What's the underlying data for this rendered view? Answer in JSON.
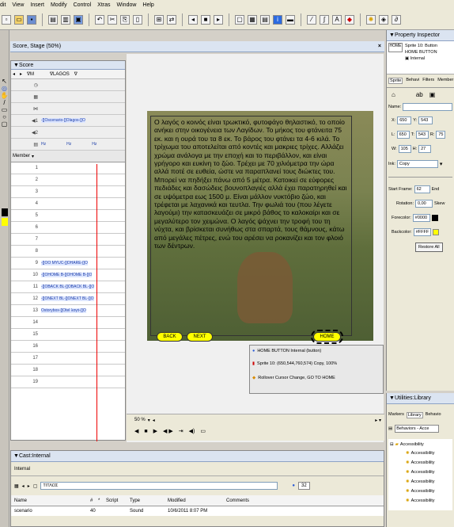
{
  "menu": [
    "dit",
    "View",
    "Insert",
    "Modify",
    "Control",
    "Xtras",
    "Window",
    "Help"
  ],
  "stage": {
    "window_title": "Score, Stage (50%)",
    "close": "×",
    "zoom": "50 %",
    "paragraph": "Ο λαγός ο κοινός είναι τρωκτικό, φυτοφάγο θηλαστικό, το οποίο ανήκει στην οικογένεια των Λαγίδων. Το μήκος του φτάνειτα 75 εκ. και η ουρά του τα 8 εκ. Το βάρος του φτάνει τα 4-6 κιλά. Το τρίχωμα του αποτελείται από κοντές και μακριες τρίχες. Αλλάζει χρώμα ανάλογα με την εποχή και το περιβάλλον, και είναι γρήγορο και ευκίνη το ζώο. Τρέχει με 70 χιλιόμετρα την ώρα αλλά ποτέ σε ευθεία, ώστε να παραπλανεί τους διώκτες του. Μπορεί να πηδήξει πάνω από 5 μέτρα. Κατοικεί σε εύφορες πεδιάδες και δασώδεις βουνοπλαγιές αλλά έχει παρατηρηθεί και σε υψόμετρα εως 1500 μ. Είναι μάλλον νυκτόβιο ζώο, και τρέφεται με λαχανικά και τευτλα. Την φωλιά του (που λέγετε λαγούμι) την κατασκευάζει σε μικρό βάθος το καλοκαίρι και σε μεγαλύτερο τον χειμώνα. Ο λαγός ψάχνει την τροφή του τη νύχτα, και βρίσκεται συνήθως στα σπαρτά, τους θάμνους, κάτω από μεγάλες πέτρες, ενώ του αρέσει να ροκανίζει και τον φλοιό των δέντρων.",
    "back": "BACK",
    "next": "NEXT",
    "home": "HOME",
    "tooltip": {
      "line1": "HOME BUTTON Internal (button)",
      "line2": "Sprite 10: (650,544,760,574) Copy, 100%",
      "line3": "Rollover Cursor Change, GO TO HOME"
    }
  },
  "score": {
    "title": "Score",
    "marker1": "∇M",
    "marker2": "∇LAGOS",
    "marker3": "∇",
    "member": "Member",
    "channel_row": "-[]Oscenario-[]Olagos-[]O",
    "hz": [
      "Hz",
      "Hz",
      "Hz"
    ],
    "rows": [
      {
        "n": "1",
        "s": ""
      },
      {
        "n": "2",
        "s": ""
      },
      {
        "n": "3",
        "s": ""
      },
      {
        "n": "4",
        "s": ""
      },
      {
        "n": "5",
        "s": ""
      },
      {
        "n": "6",
        "s": ""
      },
      {
        "n": "7",
        "s": ""
      },
      {
        "n": "8",
        "s": ""
      },
      {
        "n": "9",
        "s": "-[]OO MYUC-[]OHARE-[]O"
      },
      {
        "n": "10",
        "s": "-[]OHOME B-[]OHOME B-[]O"
      },
      {
        "n": "11",
        "s": "-[]OBACK BL-[]OBACK BL-[]O"
      },
      {
        "n": "12",
        "s": "-[]ONEXT BL-[]ONEXT BL-[]O"
      },
      {
        "n": "13",
        "s": "Ostorybox-[]Otel λαγό-[]O"
      },
      {
        "n": "14",
        "s": ""
      },
      {
        "n": "15",
        "s": ""
      },
      {
        "n": "16",
        "s": ""
      },
      {
        "n": "17",
        "s": ""
      },
      {
        "n": "18",
        "s": ""
      },
      {
        "n": "19",
        "s": ""
      }
    ]
  },
  "property_inspector": {
    "title": "Property Inspector",
    "sprite_label": "Sprite 10: Button",
    "member_name": "HOME BUTTON",
    "cast": "Internal",
    "tabs": [
      "Sprite",
      "Behavi",
      "Filters",
      "Member"
    ],
    "name_label": "Name:",
    "x_label": "X:",
    "x": "650",
    "y_label": "Y:",
    "y": "543",
    "l_label": "L:",
    "l": "650",
    "t_label": "T:",
    "t": "543",
    "r_label": "R:",
    "r": "75",
    "w_label": "W:",
    "w": "105",
    "h_label": "H:",
    "h": "27",
    "ink_label": "Ink:",
    "ink": "Copy",
    "start_frame_label": "Start Frame:",
    "start_frame": "62",
    "end_label": "End",
    "rotation_label": "Rotation:",
    "rotation": "0,00",
    "skew_label": "Skew",
    "forecolor_label": "Forecolor:",
    "forecolor": "#0000",
    "backcolor_label": "Backcolor:",
    "backcolor": "#FFFF",
    "restore": "Restore All"
  },
  "utilities": {
    "title": "Utilities:Library",
    "tabs": [
      "Markers",
      "Library",
      "Behavio"
    ],
    "category": "Behaviors - Acce",
    "tree_root": "Accessibility",
    "items": [
      "Accessibility",
      "Accessibility",
      "Accessibility",
      "Accessibility",
      "Accessibility",
      "Accessibility"
    ]
  },
  "cast": {
    "title": "Cast:Internal",
    "tab": "Internal",
    "search": "ΤΙΤΛΟΣ",
    "count": "32",
    "headers": [
      "Name",
      "#",
      "*",
      "Script",
      "Type",
      "Modified",
      "Comments"
    ],
    "first_row": {
      "name": "scenario",
      "num": "40",
      "type": "Sound",
      "modified": "10/6/2011 8:07 PM"
    }
  }
}
